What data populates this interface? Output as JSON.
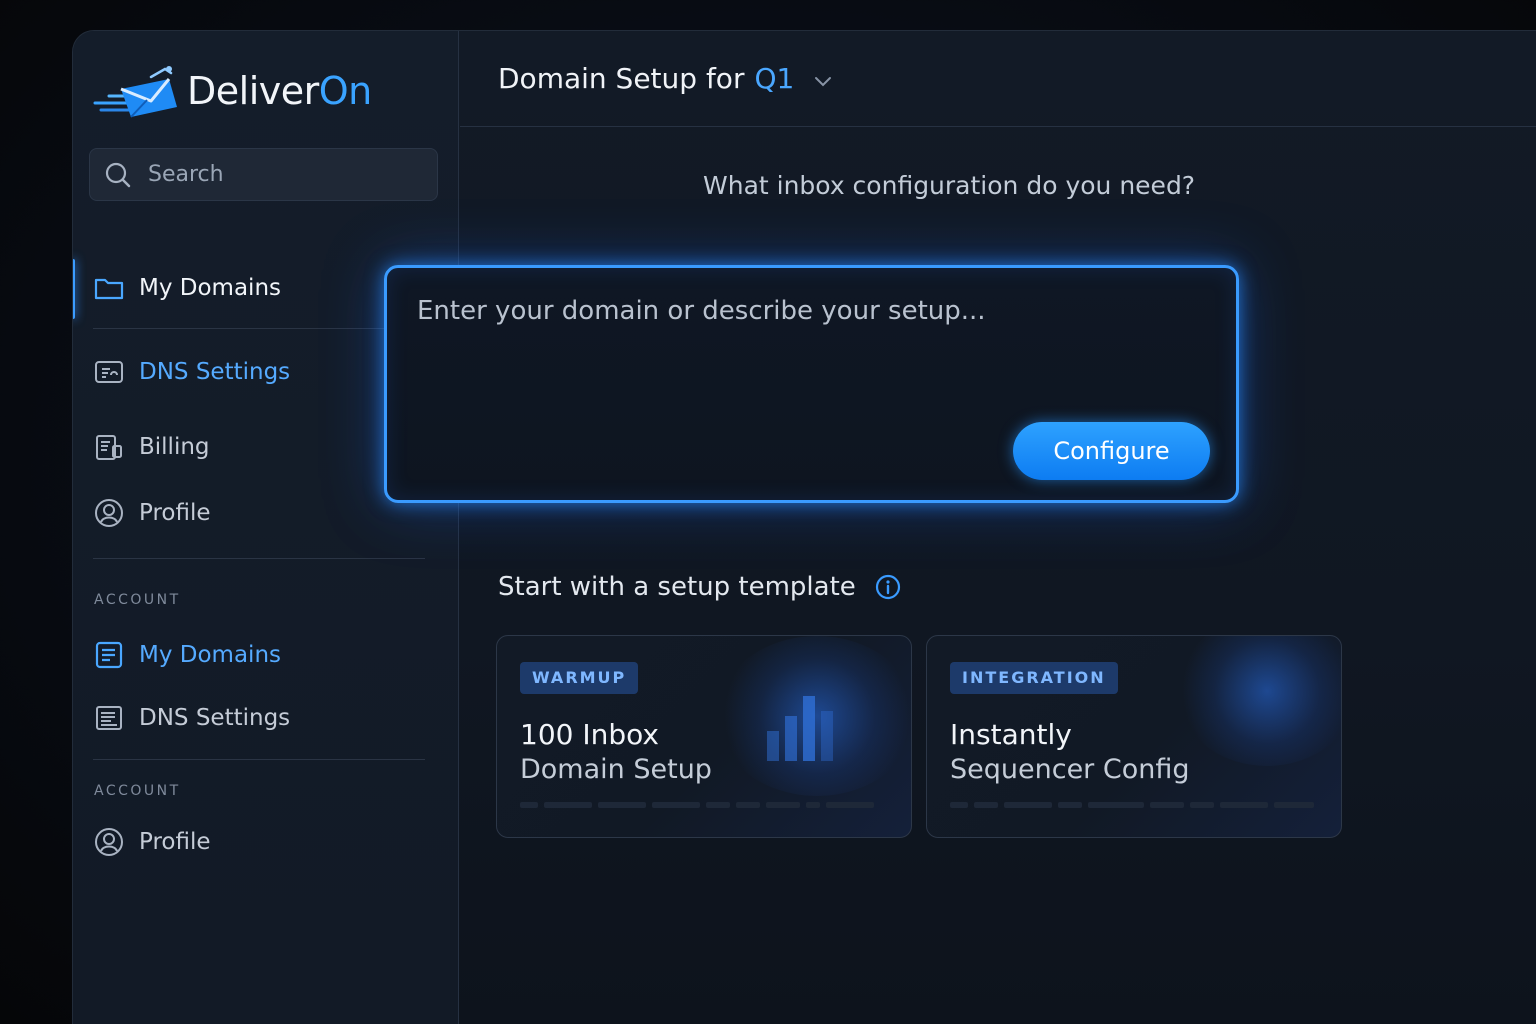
{
  "brand": {
    "name_main": "Deliver",
    "name_accent": "On"
  },
  "search": {
    "placeholder": "Search"
  },
  "sidebar": {
    "primary": [
      {
        "label": "My Domains",
        "icon": "folder-icon"
      },
      {
        "label": "DNS Settings",
        "icon": "dns-icon"
      },
      {
        "label": "Billing",
        "icon": "billing-icon"
      },
      {
        "label": "Profile",
        "icon": "user-circle-icon"
      }
    ],
    "sections": [
      {
        "label": "ACCOUNT",
        "items": [
          {
            "label": "My Domains",
            "icon": "document-icon"
          },
          {
            "label": "DNS Settings",
            "icon": "dns-list-icon"
          }
        ]
      },
      {
        "label": "ACCOUNT",
        "items": [
          {
            "label": "Profile",
            "icon": "user-circle-icon"
          }
        ]
      }
    ]
  },
  "header": {
    "title": "Domain Setup for",
    "project": "Q1"
  },
  "main": {
    "question": "What inbox configuration do you need?",
    "input_placeholder": "Enter your domain or describe your setup...",
    "configure_label": "Configure",
    "templates_title": "Start with a setup template",
    "templates": [
      {
        "badge": "WARMUP",
        "title": "100 Inbox",
        "subtitle": "Domain Setup"
      },
      {
        "badge": "INTEGRATION",
        "title": "Instantly",
        "subtitle": "Sequencer Config"
      }
    ]
  },
  "colors": {
    "accent": "#3aa3ff",
    "background": "#0b0f16",
    "panel": "#121a26",
    "badge_bg": "#1d3a6a"
  }
}
